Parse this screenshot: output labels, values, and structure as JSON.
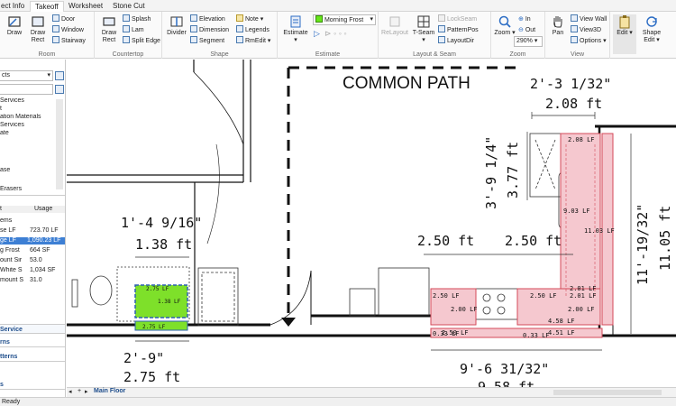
{
  "tabs": [
    "ect Info",
    "Takeoff",
    "Worksheet",
    "Stone Cut"
  ],
  "active_tab": "Takeoff",
  "ribbon": {
    "room": {
      "label": "Room",
      "draw": "Draw",
      "draw_rect": "Draw Rect",
      "door": "Door",
      "window": "Window",
      "stairway": "Stairway"
    },
    "countertop": {
      "label": "Countertop",
      "draw_rect": "Draw Rect",
      "splash": "Splash",
      "lam": "Lam",
      "split_edge": "Split Edge"
    },
    "shape": {
      "label": "Shape",
      "divider": "Divider",
      "elevation": "Elevation",
      "dimension": "Dimension",
      "segment": "Segment",
      "note": "Note",
      "legends": "Legends",
      "rmedit": "RmEdit"
    },
    "estimate": {
      "label": "Estimate",
      "estimate": "Estimate",
      "material": "Morning Frost",
      "material_color": "#66e61a"
    },
    "layout": {
      "label": "Layout & Seam",
      "relayout": "ReLayout",
      "tseam": "T-Seam",
      "lockseam": "LockSeam",
      "patternpos": "PatternPos",
      "layoutdir": "LayoutDir"
    },
    "zoom": {
      "label": "Zoom",
      "zoom": "Zoom",
      "in": "In",
      "out": "Out",
      "level": "290%"
    },
    "view": {
      "label": "View",
      "pan": "Pan",
      "view_wall": "View Wall",
      "view3d": "View3D",
      "options": "Options"
    },
    "edit": {
      "edit": "Edit",
      "shape_edit": "Shape Edit"
    }
  },
  "left_panel": {
    "dropdown": "cts",
    "tree": [
      "Services",
      "t",
      "ation Materials",
      "Services",
      "ate",
      "",
      "",
      "ase",
      "",
      "Erasers"
    ],
    "headers": [
      "t",
      "Usage"
    ],
    "rows": [
      {
        "name": "ems",
        "usage": ""
      },
      {
        "name": "se LF",
        "usage": "723.70 LF"
      },
      {
        "name": "ge LF",
        "usage": "1,090.23 LF"
      },
      {
        "name": "g Frost",
        "usage": "664 SF"
      },
      {
        "name": "ount Sir",
        "usage": "53.0"
      },
      {
        "name": "White S",
        "usage": "1,034 SF"
      },
      {
        "name": "mount S",
        "usage": "31.0"
      }
    ],
    "sections": [
      "Service",
      "rns",
      "tterns",
      "s"
    ]
  },
  "canvas": {
    "common_path": "COMMON PATH",
    "dims": {
      "top_right_ft": "2'-3 1/32\"",
      "top_right_dec": "2.08 ft",
      "left_ftin": "1'-4 9/16\"",
      "left_dec": "1.38 ft",
      "vertical_a": "3'-9 1/4\"",
      "vertical_a_dec": "3.77 ft",
      "mid_a": "2.50 ft",
      "mid_b": "2.50 ft",
      "right_vert": "11'-19/32\"",
      "right_vert_dec": "11.05 ft",
      "bottom_left": "2'-9\"",
      "bottom_left_dec": "2.75 ft",
      "bottom_right": "9'-6 31/32\"",
      "bottom_right_dec": "9.58 ft"
    },
    "counter_labels": {
      "a": "2.08 LF",
      "b": "9.03 LF",
      "b2": "0.08 LF",
      "c": "11.03 LF",
      "d": "2.50 LF",
      "e": "2.00 LF",
      "f": "2.50 LF",
      "g": "2.00 LF",
      "h": "2.01 LF",
      "i": "2.01 LF",
      "j": "4.58 LF",
      "k": "0.33 LF",
      "l": "2.50 LF",
      "m": "0.33 LF",
      "n": "4.51 LF"
    },
    "green_labels": {
      "a": "2.75 LF",
      "b": "1.38 LF",
      "c": "1.38 LF",
      "d": "2.75 LF"
    }
  },
  "bottom": {
    "add": "+",
    "sheet": "Main Floor"
  },
  "status": "Ready"
}
